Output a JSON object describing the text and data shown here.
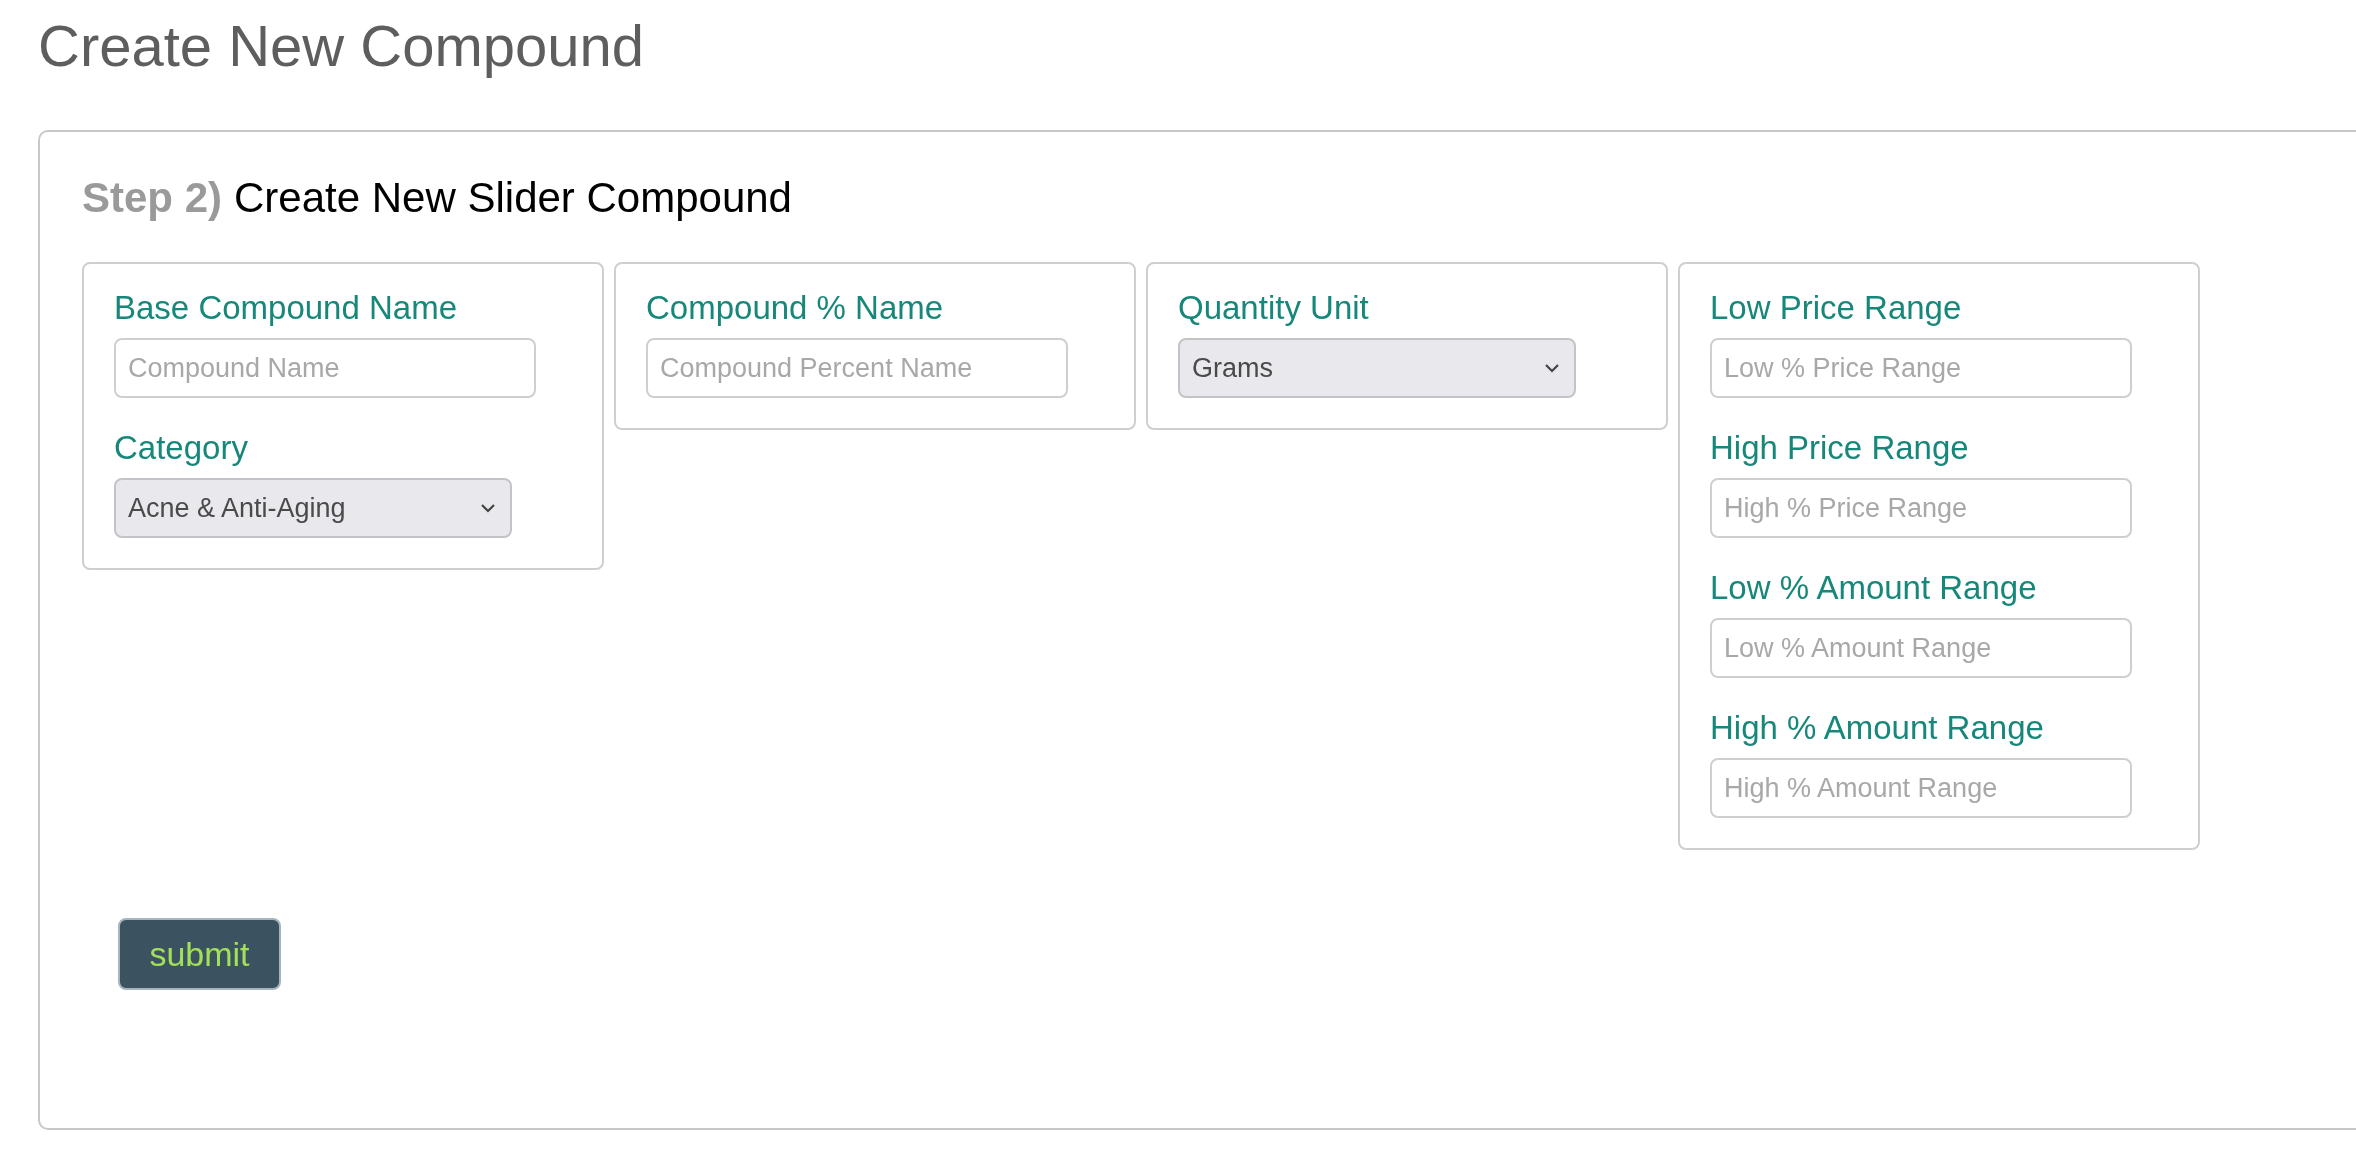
{
  "page_title": "Create New Compound",
  "step": {
    "number": "Step 2)",
    "title": "Create New Slider Compound"
  },
  "cards": [
    {
      "fields": [
        {
          "kind": "text",
          "label": "Base Compound Name",
          "placeholder": "Compound Name"
        },
        {
          "kind": "select",
          "label": "Category",
          "value": "Acne & Anti-Aging"
        }
      ]
    },
    {
      "fields": [
        {
          "kind": "text",
          "label": "Compound % Name",
          "placeholder": "Compound Percent Name"
        }
      ]
    },
    {
      "fields": [
        {
          "kind": "select",
          "label": "Quantity Unit",
          "value": "Grams"
        }
      ]
    },
    {
      "fields": [
        {
          "kind": "text",
          "label": "Low Price Range",
          "placeholder": "Low % Price Range"
        },
        {
          "kind": "text",
          "label": "High Price Range",
          "placeholder": "High % Price Range"
        },
        {
          "kind": "text",
          "label": "Low % Amount Range",
          "placeholder": "Low % Amount Range"
        },
        {
          "kind": "text",
          "label": "High % Amount Range",
          "placeholder": "High % Amount Range"
        }
      ]
    }
  ],
  "submit": "submit"
}
